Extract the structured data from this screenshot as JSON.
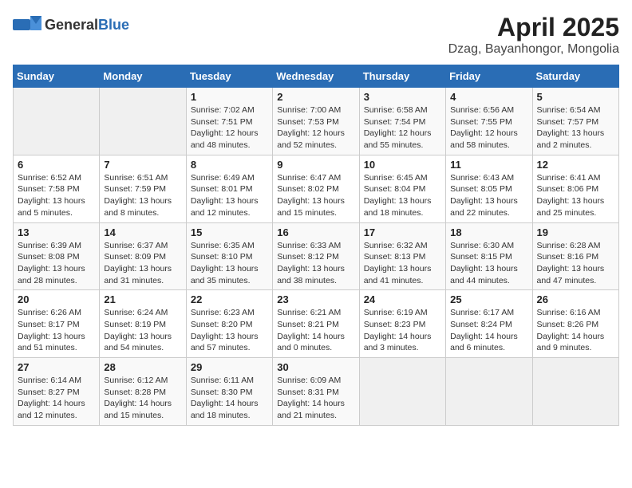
{
  "logo": {
    "general": "General",
    "blue": "Blue"
  },
  "title": "April 2025",
  "subtitle": "Dzag, Bayanhongor, Mongolia",
  "weekdays": [
    "Sunday",
    "Monday",
    "Tuesday",
    "Wednesday",
    "Thursday",
    "Friday",
    "Saturday"
  ],
  "weeks": [
    [
      {
        "day": "",
        "empty": true
      },
      {
        "day": "",
        "empty": true
      },
      {
        "day": "1",
        "sunrise": "Sunrise: 7:02 AM",
        "sunset": "Sunset: 7:51 PM",
        "daylight": "Daylight: 12 hours and 48 minutes."
      },
      {
        "day": "2",
        "sunrise": "Sunrise: 7:00 AM",
        "sunset": "Sunset: 7:53 PM",
        "daylight": "Daylight: 12 hours and 52 minutes."
      },
      {
        "day": "3",
        "sunrise": "Sunrise: 6:58 AM",
        "sunset": "Sunset: 7:54 PM",
        "daylight": "Daylight: 12 hours and 55 minutes."
      },
      {
        "day": "4",
        "sunrise": "Sunrise: 6:56 AM",
        "sunset": "Sunset: 7:55 PM",
        "daylight": "Daylight: 12 hours and 58 minutes."
      },
      {
        "day": "5",
        "sunrise": "Sunrise: 6:54 AM",
        "sunset": "Sunset: 7:57 PM",
        "daylight": "Daylight: 13 hours and 2 minutes."
      }
    ],
    [
      {
        "day": "6",
        "sunrise": "Sunrise: 6:52 AM",
        "sunset": "Sunset: 7:58 PM",
        "daylight": "Daylight: 13 hours and 5 minutes."
      },
      {
        "day": "7",
        "sunrise": "Sunrise: 6:51 AM",
        "sunset": "Sunset: 7:59 PM",
        "daylight": "Daylight: 13 hours and 8 minutes."
      },
      {
        "day": "8",
        "sunrise": "Sunrise: 6:49 AM",
        "sunset": "Sunset: 8:01 PM",
        "daylight": "Daylight: 13 hours and 12 minutes."
      },
      {
        "day": "9",
        "sunrise": "Sunrise: 6:47 AM",
        "sunset": "Sunset: 8:02 PM",
        "daylight": "Daylight: 13 hours and 15 minutes."
      },
      {
        "day": "10",
        "sunrise": "Sunrise: 6:45 AM",
        "sunset": "Sunset: 8:04 PM",
        "daylight": "Daylight: 13 hours and 18 minutes."
      },
      {
        "day": "11",
        "sunrise": "Sunrise: 6:43 AM",
        "sunset": "Sunset: 8:05 PM",
        "daylight": "Daylight: 13 hours and 22 minutes."
      },
      {
        "day": "12",
        "sunrise": "Sunrise: 6:41 AM",
        "sunset": "Sunset: 8:06 PM",
        "daylight": "Daylight: 13 hours and 25 minutes."
      }
    ],
    [
      {
        "day": "13",
        "sunrise": "Sunrise: 6:39 AM",
        "sunset": "Sunset: 8:08 PM",
        "daylight": "Daylight: 13 hours and 28 minutes."
      },
      {
        "day": "14",
        "sunrise": "Sunrise: 6:37 AM",
        "sunset": "Sunset: 8:09 PM",
        "daylight": "Daylight: 13 hours and 31 minutes."
      },
      {
        "day": "15",
        "sunrise": "Sunrise: 6:35 AM",
        "sunset": "Sunset: 8:10 PM",
        "daylight": "Daylight: 13 hours and 35 minutes."
      },
      {
        "day": "16",
        "sunrise": "Sunrise: 6:33 AM",
        "sunset": "Sunset: 8:12 PM",
        "daylight": "Daylight: 13 hours and 38 minutes."
      },
      {
        "day": "17",
        "sunrise": "Sunrise: 6:32 AM",
        "sunset": "Sunset: 8:13 PM",
        "daylight": "Daylight: 13 hours and 41 minutes."
      },
      {
        "day": "18",
        "sunrise": "Sunrise: 6:30 AM",
        "sunset": "Sunset: 8:15 PM",
        "daylight": "Daylight: 13 hours and 44 minutes."
      },
      {
        "day": "19",
        "sunrise": "Sunrise: 6:28 AM",
        "sunset": "Sunset: 8:16 PM",
        "daylight": "Daylight: 13 hours and 47 minutes."
      }
    ],
    [
      {
        "day": "20",
        "sunrise": "Sunrise: 6:26 AM",
        "sunset": "Sunset: 8:17 PM",
        "daylight": "Daylight: 13 hours and 51 minutes."
      },
      {
        "day": "21",
        "sunrise": "Sunrise: 6:24 AM",
        "sunset": "Sunset: 8:19 PM",
        "daylight": "Daylight: 13 hours and 54 minutes."
      },
      {
        "day": "22",
        "sunrise": "Sunrise: 6:23 AM",
        "sunset": "Sunset: 8:20 PM",
        "daylight": "Daylight: 13 hours and 57 minutes."
      },
      {
        "day": "23",
        "sunrise": "Sunrise: 6:21 AM",
        "sunset": "Sunset: 8:21 PM",
        "daylight": "Daylight: 14 hours and 0 minutes."
      },
      {
        "day": "24",
        "sunrise": "Sunrise: 6:19 AM",
        "sunset": "Sunset: 8:23 PM",
        "daylight": "Daylight: 14 hours and 3 minutes."
      },
      {
        "day": "25",
        "sunrise": "Sunrise: 6:17 AM",
        "sunset": "Sunset: 8:24 PM",
        "daylight": "Daylight: 14 hours and 6 minutes."
      },
      {
        "day": "26",
        "sunrise": "Sunrise: 6:16 AM",
        "sunset": "Sunset: 8:26 PM",
        "daylight": "Daylight: 14 hours and 9 minutes."
      }
    ],
    [
      {
        "day": "27",
        "sunrise": "Sunrise: 6:14 AM",
        "sunset": "Sunset: 8:27 PM",
        "daylight": "Daylight: 14 hours and 12 minutes."
      },
      {
        "day": "28",
        "sunrise": "Sunrise: 6:12 AM",
        "sunset": "Sunset: 8:28 PM",
        "daylight": "Daylight: 14 hours and 15 minutes."
      },
      {
        "day": "29",
        "sunrise": "Sunrise: 6:11 AM",
        "sunset": "Sunset: 8:30 PM",
        "daylight": "Daylight: 14 hours and 18 minutes."
      },
      {
        "day": "30",
        "sunrise": "Sunrise: 6:09 AM",
        "sunset": "Sunset: 8:31 PM",
        "daylight": "Daylight: 14 hours and 21 minutes."
      },
      {
        "day": "",
        "empty": true
      },
      {
        "day": "",
        "empty": true
      },
      {
        "day": "",
        "empty": true
      }
    ]
  ]
}
